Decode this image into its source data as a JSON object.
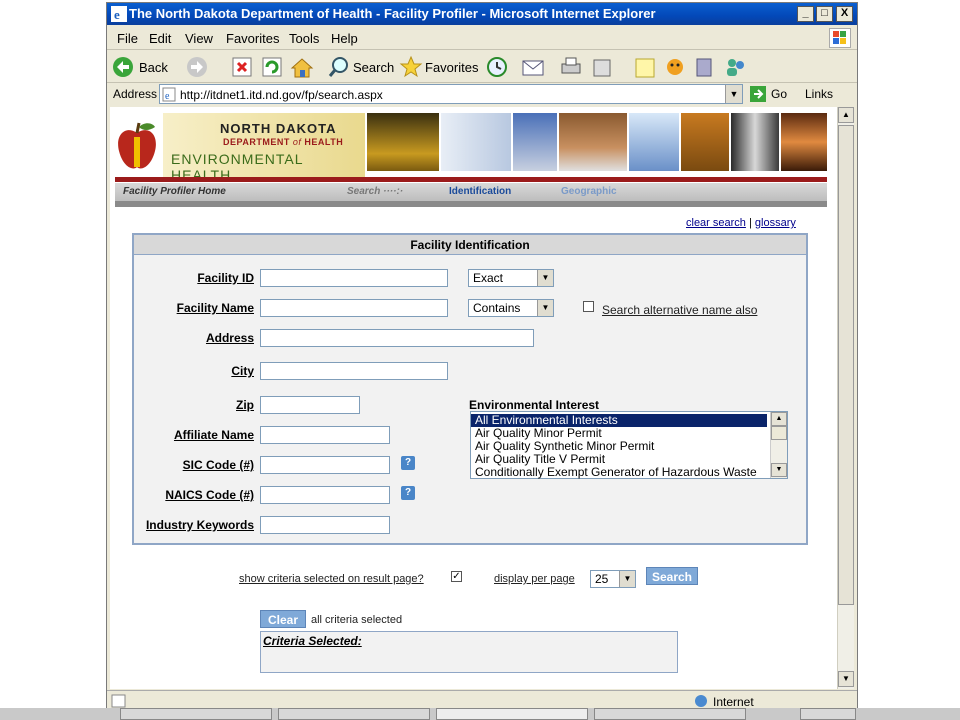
{
  "window": {
    "title": "The North Dakota Department of Health - Facility Profiler - Microsoft Internet Explorer",
    "controls": [
      "_",
      "□",
      "X"
    ]
  },
  "menu": [
    "File",
    "Edit",
    "View",
    "Favorites",
    "Tools",
    "Help"
  ],
  "toolbar": {
    "back": "Back",
    "search": "Search",
    "favorites": "Favorites"
  },
  "address": {
    "label": "Address",
    "url": "http://itdnet1.itd.nd.gov/fp/search.aspx",
    "go": "Go",
    "links": "Links"
  },
  "header": {
    "logo_line1": "NORTH DAKOTA",
    "logo_line2_a": "DEPARTMENT",
    "logo_line2_of": "of",
    "logo_line2_b": "HEALTH",
    "logo_line3": "ENVIRONMENTAL HEALTH"
  },
  "nav": {
    "home": "Facility Profiler Home",
    "search": "Search ····:·",
    "identification": "Identification",
    "geographic": "Geographic"
  },
  "toplinks": {
    "clear_search": "clear search",
    "sep": "|",
    "glossary": "glossary"
  },
  "panel": {
    "title": "Facility Identification",
    "labels": {
      "facility_id": "Facility ID",
      "facility_name": "Facility Name",
      "address": "Address",
      "city": "City",
      "zip": "Zip",
      "affiliate_name": "Affiliate Name",
      "sic_code": "SIC Code (#)",
      "naics_code": "NAICS Code (#)",
      "industry_keywords": "Industry Keywords"
    },
    "facility_id_match": "Exact",
    "facility_name_match": "Contains",
    "alt_name_label": "Search alternative name also",
    "env_interest_label": "Environmental Interest",
    "env_interests": [
      "All Environmental Interests",
      "Air Quality Minor Permit",
      "Air Quality Synthetic Minor Permit",
      "Air Quality Title V Permit",
      "Conditionally Exempt Generator of Hazardous Waste"
    ],
    "help_glyph": "?"
  },
  "options": {
    "show_criteria": "show criteria selected on result page?",
    "show_criteria_checked": true,
    "display_per_page": "display per page",
    "per_page_value": "25",
    "search_button": "Search"
  },
  "criteria": {
    "clear_button": "Clear",
    "status": "all criteria selected",
    "heading": "Criteria Selected:"
  },
  "status": {
    "zone": "Internet"
  }
}
